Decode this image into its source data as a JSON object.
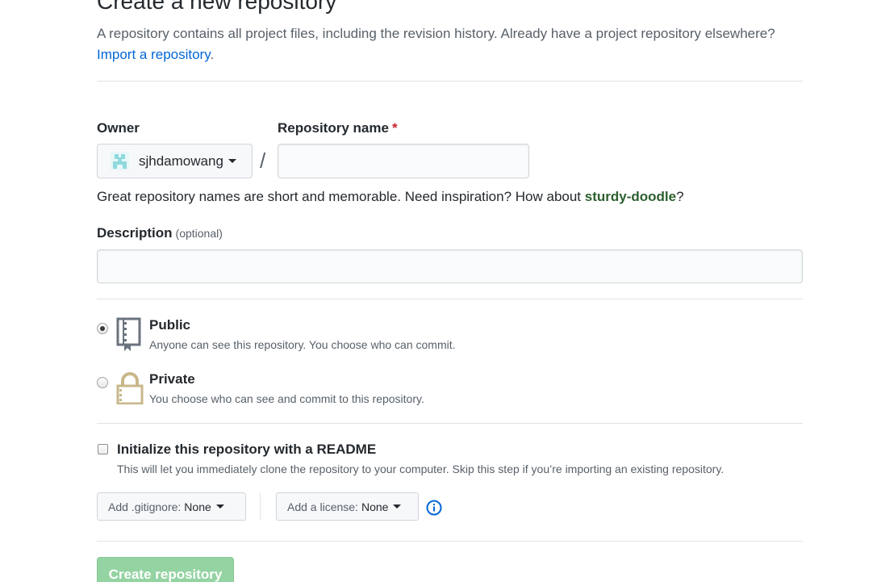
{
  "header": {
    "title": "Create a new repository",
    "subtitle": "A repository contains all project files, including the revision history. Already have a project repository elsewhere?",
    "import_link": "Import a repository",
    "import_suffix": "."
  },
  "form": {
    "owner_label": "Owner",
    "owner_value": "sjhdamowang",
    "separator": "/",
    "repo_name_label": "Repository name",
    "required_mark": "*",
    "repo_name_value": "",
    "hint_text": "Great repository names are short and memorable. Need inspiration? How about ",
    "hint_suggestion": "sturdy-doodle",
    "hint_suffix": "?",
    "description_label": "Description",
    "description_optional": "(optional)",
    "description_value": ""
  },
  "visibility": {
    "selected": "public",
    "public": {
      "title": "Public",
      "desc": "Anyone can see this repository. You choose who can commit."
    },
    "private": {
      "title": "Private",
      "desc": "You choose who can see and commit to this repository."
    }
  },
  "init": {
    "checked": false,
    "title": "Initialize this repository with a README",
    "desc": "This will let you immediately clone the repository to your computer. Skip this step if you’re importing an existing repository."
  },
  "extras": {
    "gitignore_prefix": "Add .gitignore:",
    "gitignore_value": "None",
    "license_prefix": "Add a license:",
    "license_value": "None"
  },
  "submit": {
    "label": "Create repository",
    "disabled": true
  },
  "colors": {
    "link": "#0366d6",
    "required": "#cb2431",
    "suggestion": "#2c5f2e",
    "submit_bg": "#94d3a2",
    "private_lock": "#c9b78a"
  },
  "icons": {
    "public": "repo-book-icon",
    "private": "lock-icon",
    "info": "info-icon"
  }
}
